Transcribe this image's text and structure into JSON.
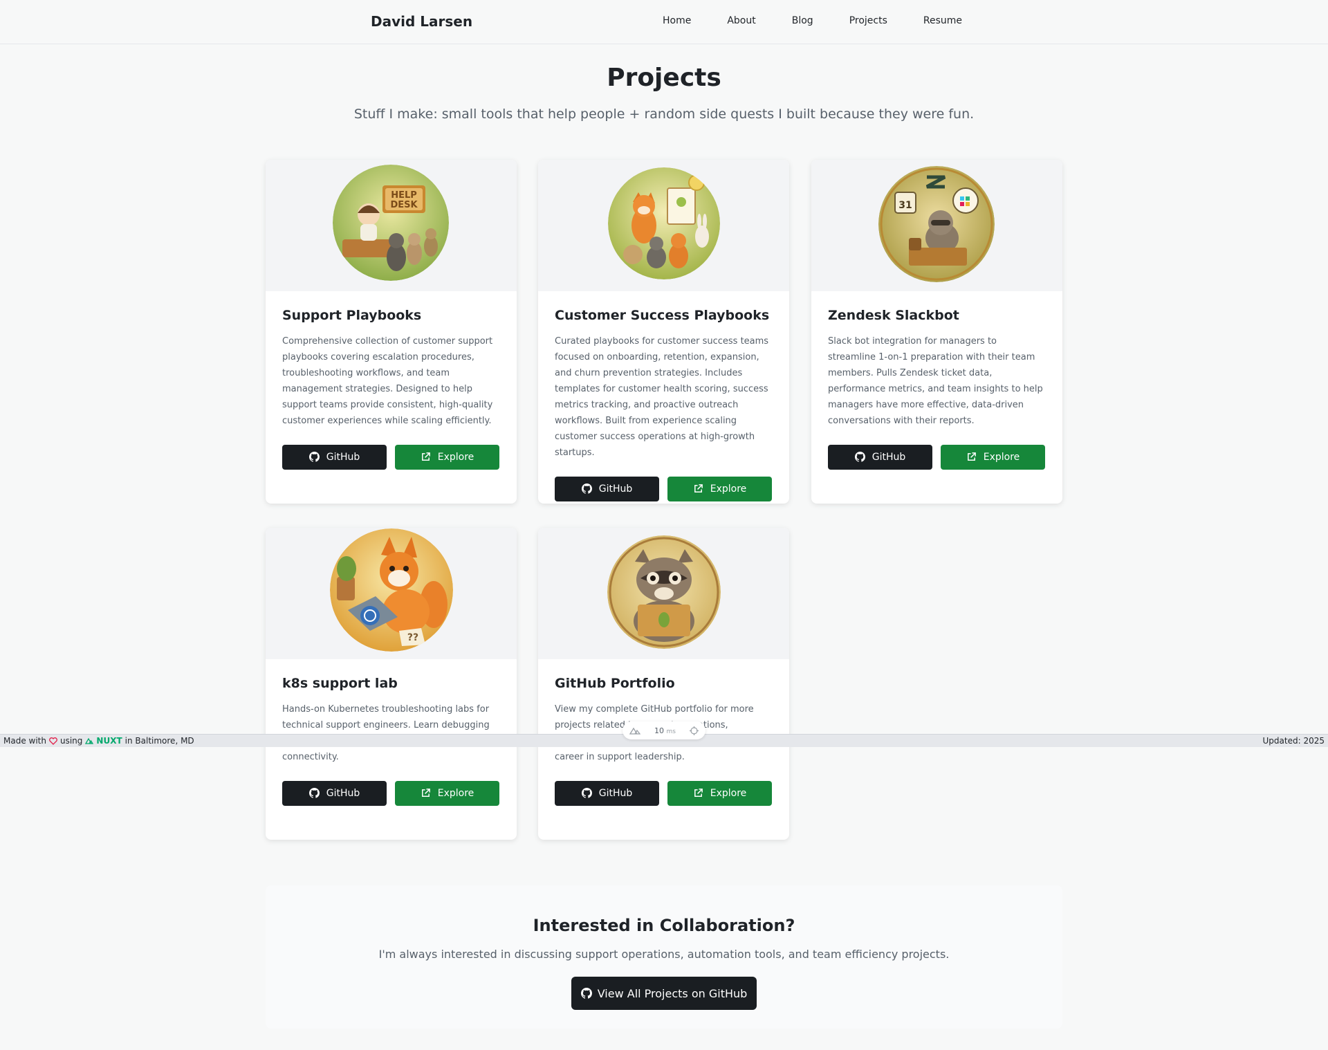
{
  "nav": {
    "brand": "David Larsen",
    "links": [
      "Home",
      "About",
      "Blog",
      "Projects",
      "Resume"
    ]
  },
  "hero": {
    "title": "Projects",
    "subtitle": "Stuff I make: small tools that help people + random side quests I built because they were fun."
  },
  "projects": [
    {
      "title": "Support Playbooks",
      "desc": "Comprehensive collection of customer support playbooks covering escalation procedures, troubleshooting workflows, and team management strategies. Designed to help support teams provide consistent, high-quality customer experiences while scaling efficiently.",
      "github_label": "GitHub",
      "explore_label": "Explore",
      "image_theme": "help desk illustration"
    },
    {
      "title": "Customer Success Playbooks",
      "desc": "Curated playbooks for customer success teams focused on onboarding, retention, expansion, and churn prevention strategies. Includes templates for customer health scoring, success metrics tracking, and proactive outreach workflows. Built from experience scaling customer success operations at high-growth startups.",
      "github_label": "GitHub",
      "explore_label": "Explore",
      "image_theme": "fox teaching animals illustration"
    },
    {
      "title": "Zendesk Slackbot",
      "desc": "Slack bot integration for managers to streamline 1-on-1 preparation with their team members. Pulls Zendesk ticket data, performance metrics, and team insights to help managers have more effective, data-driven conversations with their reports.",
      "github_label": "GitHub",
      "explore_label": "Explore",
      "image_theme": "raccoon with zendesk and slack icons illustration"
    },
    {
      "title": "k8s support lab",
      "desc": "Hands-on Kubernetes troubleshooting labs for technical support engineers. Learn debugging CrashLoopBackOff, DNS issues, and service connectivity.",
      "github_label": "GitHub",
      "explore_label": "Explore",
      "image_theme": "fox with kubernetes laptop illustration"
    },
    {
      "title": "GitHub Portfolio",
      "desc": "View my complete GitHub portfolio for more projects related to support operations, troubleshooting solutions built throughout my career in support leadership.",
      "github_label": "GitHub",
      "explore_label": "Explore",
      "image_theme": "raccoon with laptop illustration"
    }
  ],
  "collab": {
    "title": "Interested in Collaboration?",
    "text": "I'm always interested in discussing support operations, automation tools, and team efficiency projects.",
    "button_label": "View All Projects on GitHub"
  },
  "footer": {
    "made_with": "Made with",
    "using": "using",
    "framework": "NUXT",
    "location": "in Baltimore, MD",
    "updated": "Updated: 2025"
  },
  "devtools": {
    "ms_value": "10",
    "ms_unit": "ms"
  },
  "colors": {
    "accent_green": "#16873a",
    "button_dark": "#1a1e22",
    "nuxt_green": "#00a86b",
    "heart": "#e11d48"
  }
}
